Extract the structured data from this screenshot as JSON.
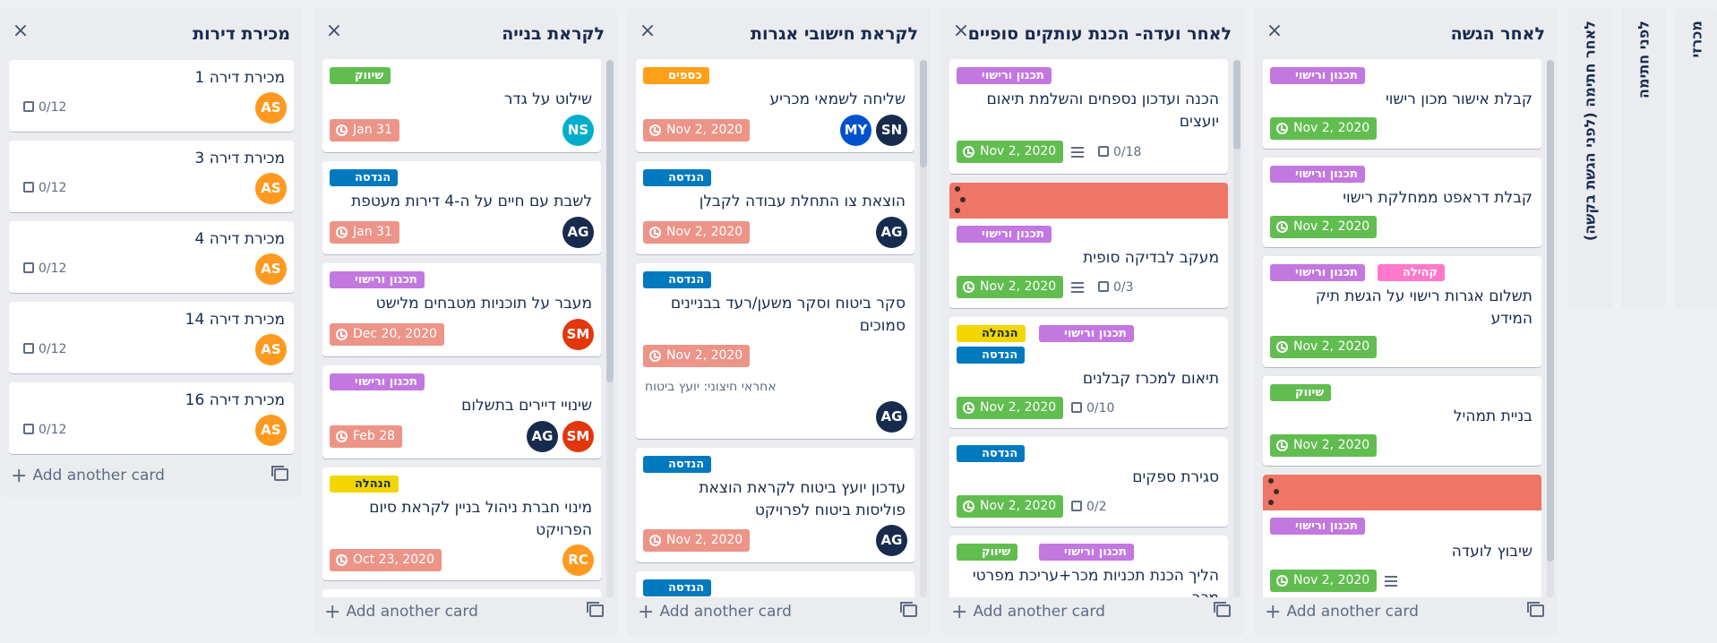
{
  "lists": [
    {
      "title": "מכירת דירות",
      "add_card": "Add another card",
      "cards": [
        {
          "title": "מכירת דירה 1",
          "checklist": "0/12",
          "avatars": [
            "AS"
          ]
        },
        {
          "title": "מכירת דירה 3",
          "checklist": "0/12",
          "avatars": [
            "AS"
          ]
        },
        {
          "title": "מכירת דירה 4",
          "checklist": "0/12",
          "avatars": [
            "AS"
          ]
        },
        {
          "title": "מכירת דירה 14",
          "checklist": "0/12",
          "avatars": [
            "AS"
          ]
        },
        {
          "title": "מכירת דירה 16",
          "checklist": "0/12",
          "avatars": [
            "AS"
          ]
        }
      ]
    },
    {
      "title": "לקראת בנייה",
      "add_card": "Add another card",
      "cards": [
        {
          "labels": [
            "שיווק"
          ],
          "title": "שילוט על גדר",
          "due": "Jan 31",
          "avatars": [
            "NS"
          ]
        },
        {
          "labels": [
            "הנדסה"
          ],
          "title": "לשבת עם חיים על ה-4 דירות מעטפת",
          "due": "Jan 31",
          "avatars": [
            "AG"
          ]
        },
        {
          "labels": [
            "תכנון ורישוי"
          ],
          "title": "מעבר על תוכניות מטבחים מלישט",
          "due": "Dec 20, 2020",
          "avatars": [
            "SM"
          ]
        },
        {
          "labels": [
            "תכנון ורישוי"
          ],
          "title": "שינויי דיירים בתשלום",
          "due": "Feb 28",
          "avatars": [
            "AG",
            "SM"
          ]
        },
        {
          "labels": [
            "הנהלה"
          ],
          "title_lines": [
            "מינוי חברת ניהול בניין לקראת סיום",
            "הפרויקט"
          ],
          "due": "Oct 23, 2020",
          "avatars": [
            "RC"
          ]
        }
      ]
    },
    {
      "title": "לקראת חישובי אגרות",
      "add_card": "Add another card",
      "cards": [
        {
          "labels": [
            "כספים"
          ],
          "title": "שליחה לשמאי מכריע",
          "due": "Nov 2, 2020",
          "avatars": [
            "MY",
            "SN"
          ]
        },
        {
          "labels": [
            "הנדסה"
          ],
          "title": "הוצאת צו התחלת עבודה לקבלן",
          "due": "Nov 2, 2020",
          "avatars": [
            "AG"
          ]
        },
        {
          "labels": [
            "הנדסה"
          ],
          "title_lines": [
            "סקר ביטוח וסקר משען/רעד בבניינים",
            "סמוכים"
          ],
          "due": "Nov 2, 2020",
          "note": "אחראי חיצוני: יועץ ביטוח",
          "avatars": [
            "AG"
          ]
        },
        {
          "labels": [
            "הנדסה"
          ],
          "title_lines": [
            "עדכון יועץ ביטוח לקראת הוצאת",
            "פוליסות ביטוח לפרויקט"
          ],
          "due": "Nov 2, 2020",
          "avatars": [
            "AG"
          ]
        },
        {
          "labels": [
            "הנדסה"
          ]
        }
      ]
    },
    {
      "title": "לאחר ועדה- הכנת עותקים סופיים",
      "add_card": "Add another card",
      "cards": [
        {
          "labels": [
            "תכנון ורישוי"
          ],
          "title_lines": [
            "הכנה ועדכון נספחים והשלמת תיאום",
            "יועצים"
          ],
          "due": "Nov 2, 2020",
          "checklist": "0/18"
        },
        {
          "labels": [
            "תכנון ורישוי"
          ],
          "title": "מעקב לבדיקה סופית",
          "due": "Nov 2, 2020",
          "checklist": "0/3"
        },
        {
          "labels": [
            "תכנון ורישוי",
            "הנהלה",
            "הנדסה"
          ],
          "title": "תיאום למכרז קבלנים",
          "due": "Nov 2, 2020",
          "checklist": "0/10"
        },
        {
          "labels": [
            "הנדסה"
          ],
          "title": "סגירת ספקים",
          "due": "Nov 2, 2020",
          "checklist": "0/2"
        },
        {
          "labels": [
            "תכנון ורישוי",
            "שיווק"
          ],
          "title_lines": [
            "הליך הכנת תכניות מכר+עריכת מפרטי",
            "מכר"
          ]
        }
      ]
    },
    {
      "title": "לאחר הגשה",
      "add_card": "Add another card",
      "cards": [
        {
          "labels": [
            "תכנון ורישוי"
          ],
          "title": "קבלת אישור מכון רישוי",
          "due": "Nov 2, 2020"
        },
        {
          "labels": [
            "תכנון ורישוי"
          ],
          "title": "קבלת דראפט ממחלקת רישוי",
          "due": "Nov 2, 2020"
        },
        {
          "labels": [
            "תכנון ורישוי",
            "קהילה"
          ],
          "title_lines": [
            "תשלום אגרות רישוי על הגשת תיק",
            "המידע"
          ],
          "due": "Nov 2, 2020"
        },
        {
          "labels": [
            "שיווק"
          ],
          "title": "בניית תמהיל",
          "due": "Nov 2, 2020"
        },
        {
          "labels": [
            "תכנון ורישוי"
          ],
          "title": "שיבוץ לועדה",
          "due": "Nov 2, 2020"
        }
      ]
    }
  ],
  "collapsed_lists": [
    "לאחר חתימה (לפני הגשת בקשה)",
    "לפני חתימה",
    "מכרזי"
  ],
  "colors": {
    "purple": "#c377e0",
    "blue": "#0079bf",
    "green": "#61bd4f",
    "orange": "#ff9f1a",
    "yellow": "#f2d600",
    "pink": "#ff78cb",
    "red_cover": "#ef7564",
    "due_green": "#61bd4f",
    "due_red": "#ec9488"
  }
}
